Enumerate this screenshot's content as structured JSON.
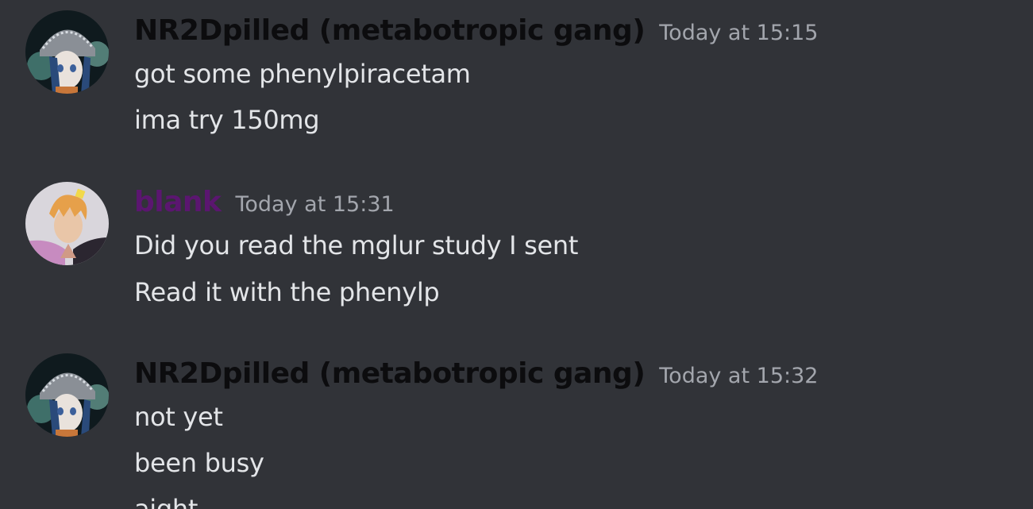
{
  "messages": [
    {
      "author": "NR2Dpilled (metabotropic gang)",
      "timestamp": "Today at 15:15",
      "author_color": "#0c0c0e",
      "avatar": "anime-avatar-helmet",
      "lines": [
        "got some phenylpiracetam",
        "ima try 150mg"
      ]
    },
    {
      "author": "blank",
      "timestamp": "Today at 15:31",
      "author_color": "#5b1670",
      "avatar": "anime-avatar-blond",
      "lines": [
        "Did you read the mglur study I sent",
        "Read it with the phenylp"
      ]
    },
    {
      "author": "NR2Dpilled (metabotropic gang)",
      "timestamp": "Today at 15:32",
      "author_color": "#0c0c0e",
      "avatar": "anime-avatar-helmet",
      "lines": [
        "not yet",
        "been busy",
        "aight"
      ]
    }
  ],
  "colors": {
    "background": "#313338",
    "message_text": "#e3e5e8",
    "timestamp": "#a3a6ad"
  }
}
